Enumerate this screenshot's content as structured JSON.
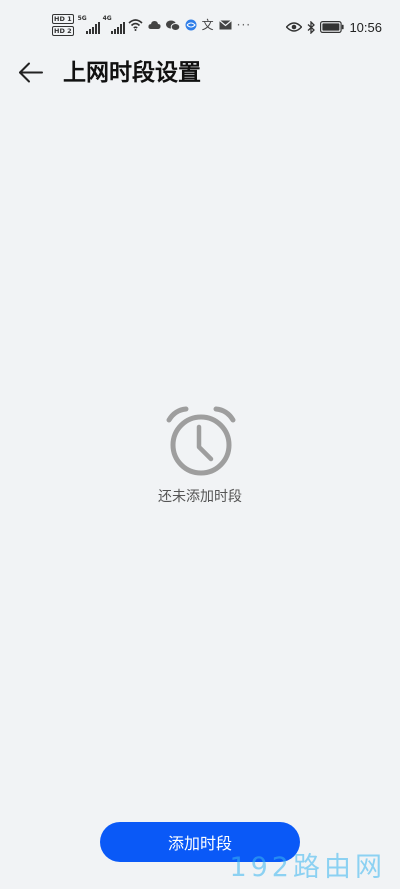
{
  "status_bar": {
    "sim1": "HD 1",
    "sim2": "HD 2",
    "sig1_tag": "5G",
    "sig2_tag": "4G",
    "lang_glyph": "文",
    "more": "···",
    "time": "10:56",
    "icons": [
      "hd-icon",
      "signal-icon",
      "wifi-icon",
      "cloud-icon",
      "wechat-icon",
      "browser-icon",
      "translate-icon",
      "mail-icon",
      "eye-icon",
      "bluetooth-icon",
      "battery-icon"
    ]
  },
  "header": {
    "title": "上网时段设置",
    "back_icon": "arrow-left-icon"
  },
  "empty_state": {
    "icon": "alarm-clock-icon",
    "icon_color": "#9e9e9e",
    "message": "还未添加时段"
  },
  "footer": {
    "add_label": "添加时段",
    "button_color": "#0a59f7"
  },
  "watermark": {
    "text": "192路由网"
  }
}
